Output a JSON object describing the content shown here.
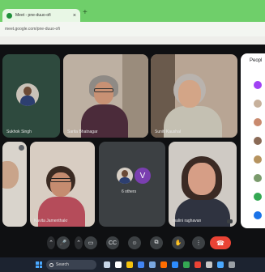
{
  "browser": {
    "tab_title": "Meet - pne-duuo-ofi",
    "tab_close": "×",
    "new_tab": "+",
    "address": "meet.google.com/pne-duuo-ofi"
  },
  "tiles": {
    "sukhok": "Sukhok Singh",
    "sarita": "Sarita Bhatnagar",
    "suniti": "Suniti Kaushal",
    "kavita": "Kavita Jamenthakr",
    "others": "6 others",
    "others_initial": "V",
    "malini": "malini raghavan"
  },
  "people_panel": {
    "title": "Peopl"
  },
  "controls": {
    "mic": "🎤",
    "cam": "▭",
    "captions": "CC",
    "emoji": "☺",
    "present": "⧉",
    "hand": "✋",
    "more": "⋮",
    "hangup": "☎"
  },
  "taskbar": {
    "search_text": "Search"
  },
  "colors": {
    "accent_green": "#6fcf6a",
    "hangup_red": "#ea4335",
    "meet_bg": "#0f1012",
    "taskbar": "#1c2330"
  }
}
